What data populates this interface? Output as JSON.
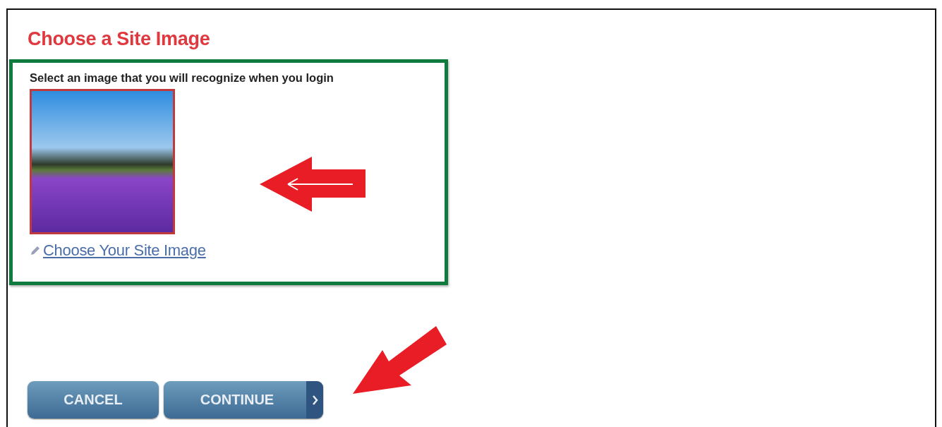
{
  "title": "Choose a Site Image",
  "panel": {
    "instruction": "Select an image that you will recognize when you login",
    "link": "Choose Your Site Image"
  },
  "buttons": [
    {
      "label": "CANCEL",
      "kind": "plain"
    },
    {
      "label": "CONTINUE",
      "kind": "next"
    }
  ]
}
